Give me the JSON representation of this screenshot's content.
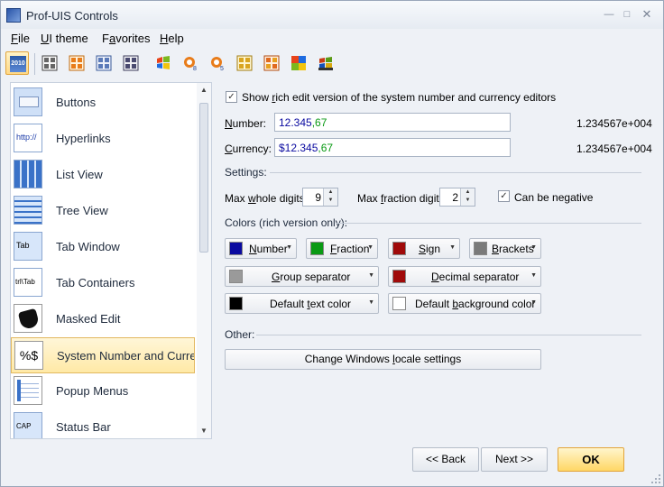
{
  "window": {
    "title": "Prof-UIS Controls"
  },
  "menu": [
    {
      "pre": "",
      "u": "F",
      "post": "ile"
    },
    {
      "pre": "",
      "u": "U",
      "post": "I theme"
    },
    {
      "pre": "F",
      "u": "a",
      "post": "vorites"
    },
    {
      "pre": "",
      "u": "H",
      "post": "elp"
    }
  ],
  "toolbar": {
    "theme_2010_label": "2010",
    "items": [
      "office-2010-theme",
      "office-2003-theme",
      "office-2007-theme",
      "studio-2005-theme",
      "studio-2008-theme",
      "winxp-theme",
      "windows-8-theme",
      "windows-5-theme",
      "office-xp-theme",
      "office-2000-theme",
      "puzzle-theme",
      "windows-classic-theme"
    ]
  },
  "nav": {
    "items": [
      {
        "label": "Buttons"
      },
      {
        "label": "Hyperlinks",
        "icon_text": "http://"
      },
      {
        "label": "List View"
      },
      {
        "label": "Tree View"
      },
      {
        "label": "Tab Window",
        "icon_text": "Tab"
      },
      {
        "label": "Tab Containers",
        "icon_text": "trl\\Tab"
      },
      {
        "label": "Masked Edit"
      },
      {
        "label": "System Number and Currency",
        "icon_text": "%$"
      },
      {
        "label": "Popup Menus"
      },
      {
        "label": "Status Bar",
        "icon_text": "CAP"
      }
    ]
  },
  "rich_edit": {
    "pre": "Show ",
    "u": "r",
    "post": "ich edit version of the system number and currency editors",
    "checked": true
  },
  "number": {
    "label_u": "N",
    "label_post": "umber:",
    "value_main": "12.345",
    "value_frac": ",67",
    "scientific": "1.234567e+004"
  },
  "currency": {
    "label_u": "C",
    "label_post": "urrency:",
    "value_main": "$12.345",
    "value_frac": ",67",
    "scientific": "1.234567e+004"
  },
  "settings": {
    "heading": "Settings:",
    "max_whole_pre": "Max ",
    "max_whole_u": "w",
    "max_whole_post": "hole digits:",
    "max_whole_value": "9",
    "max_frac_pre": "Max ",
    "max_frac_u": "f",
    "max_frac_post": "raction digits:",
    "max_frac_value": "2",
    "negative_pre": "Can be ne",
    "negative_u": "g",
    "negative_post": "ative",
    "negative_checked": true
  },
  "colors": {
    "heading": "Colors (rich version only):",
    "number": {
      "pre": "",
      "u": "N",
      "post": "umber",
      "color": "#0a0aa0"
    },
    "fraction": {
      "pre": "",
      "u": "F",
      "post": "raction",
      "color": "#0a9a14"
    },
    "sign": {
      "pre": "",
      "u": "S",
      "post": "ign",
      "color": "#a00a0a"
    },
    "brackets": {
      "pre": "",
      "u": "B",
      "post": "rackets",
      "color": "#7a7a7a"
    },
    "group_separator": {
      "pre": "",
      "u": "G",
      "post": "roup separator",
      "color": "#9a9a9a"
    },
    "decimal_separator": {
      "pre": "",
      "u": "D",
      "post": "ecimal separator",
      "color": "#a00a0a"
    },
    "default_text": {
      "pre": "Default ",
      "u": "t",
      "post": "ext color",
      "color": "#000000"
    },
    "default_background": {
      "pre": "Default ",
      "u": "b",
      "post": "ackground color",
      "color": "#ffffff"
    }
  },
  "other": {
    "heading": "Other:",
    "locale_pre": "Change Windows ",
    "locale_u": "l",
    "locale_post": "ocale settings"
  },
  "footer": {
    "back": "<< Back",
    "next": "Next >>",
    "ok": "OK"
  }
}
